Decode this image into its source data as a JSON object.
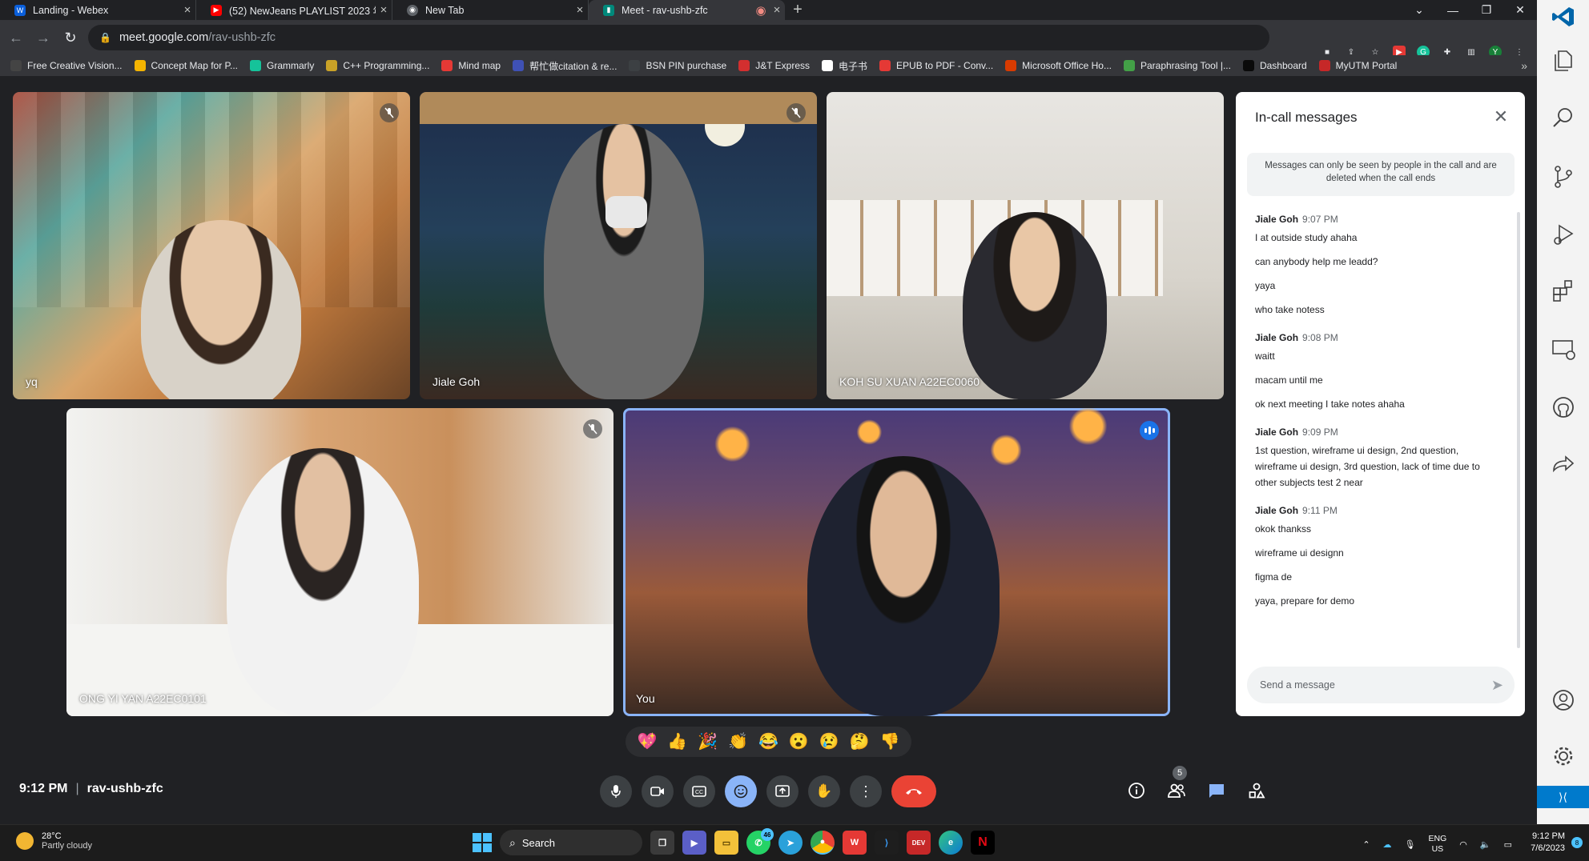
{
  "browser": {
    "tabs": [
      {
        "title": "Landing - Webex",
        "color": "#0a5fdb"
      },
      {
        "title": "(52) NewJeans PLAYLIST 2023 年",
        "color": "#ff0000"
      },
      {
        "title": "New Tab",
        "color": "#5f6368"
      },
      {
        "title": "Meet - rav-ushb-zfc",
        "color": "#00897b"
      }
    ],
    "url_host": "meet.google.com",
    "url_path": "/rav-ushb-zfc",
    "profile_initial": "Y",
    "bookmarks": [
      {
        "label": "Free Creative Vision...",
        "color": "#444444",
        "icon": "image-icon"
      },
      {
        "label": "Concept Map for P...",
        "color": "#f4b400",
        "icon": "concept-map-icon"
      },
      {
        "label": "Grammarly",
        "color": "#15c39a",
        "icon": "grammarly-icon"
      },
      {
        "label": "C++ Programming...",
        "color": "#c9a227",
        "icon": "cpp-icon"
      },
      {
        "label": "Mind map",
        "color": "#e53935",
        "icon": "mindmap-icon"
      },
      {
        "label": "帮忙做citation & re...",
        "color": "#3f51b5",
        "icon": "citation-icon"
      },
      {
        "label": "BSN PIN purchase",
        "color": "#3c4043",
        "icon": "globe-icon"
      },
      {
        "label": "J&T Express",
        "color": "#d32f2f",
        "icon": "jt-icon"
      },
      {
        "label": "电子书",
        "color": "#ffffff",
        "icon": "book-icon"
      },
      {
        "label": "EPUB to PDF - Conv...",
        "color": "#e53935",
        "icon": "epub-icon"
      },
      {
        "label": "Microsoft Office Ho...",
        "color": "#d83b01",
        "icon": "office-icon"
      },
      {
        "label": "Paraphrasing Tool |...",
        "color": "#43a047",
        "icon": "paraphrase-icon"
      },
      {
        "label": "Dashboard",
        "color": "#0a0a0a",
        "icon": "dashboard-icon"
      },
      {
        "label": "MyUTM Portal",
        "color": "#c62828",
        "icon": "utm-icon"
      }
    ]
  },
  "participants": [
    {
      "name": "yq",
      "muted": true
    },
    {
      "name": "Jiale Goh",
      "muted": true
    },
    {
      "name": "KOH SU XUAN A22EC0060",
      "muted": false
    },
    {
      "name": "ONG YI YAN A22EC0101",
      "muted": true
    },
    {
      "name": "You",
      "speaking": true
    }
  ],
  "chat": {
    "title": "In-call messages",
    "notice": "Messages can only be seen by people in the call and are deleted when the call ends",
    "groups": [
      {
        "sender": "Jiale Goh",
        "time": "9:07 PM",
        "lines": [
          "I at outside study ahaha",
          "can anybody help me leadd?",
          "yaya",
          "who take notess"
        ]
      },
      {
        "sender": "Jiale Goh",
        "time": "9:08 PM",
        "lines": [
          "waitt",
          "macam until me",
          "ok next meeting I take notes ahaha"
        ]
      },
      {
        "sender": "Jiale Goh",
        "time": "9:09 PM",
        "lines": [
          "1st question, wireframe ui design, 2nd question, wireframe ui design, 3rd question, lack of time due to other subjects test 2 near"
        ]
      },
      {
        "sender": "Jiale Goh",
        "time": "9:11 PM",
        "lines": [
          "okok thankss",
          "wireframe ui designn",
          "figma de",
          "yaya, prepare for demo"
        ]
      }
    ],
    "input_placeholder": "Send a message"
  },
  "reactions": [
    "💖",
    "👍",
    "🎉",
    "👏",
    "😂",
    "😮",
    "😢",
    "🤔",
    "👎"
  ],
  "meeting": {
    "time": "9:12 PM",
    "code": "rav-ushb-zfc",
    "people_count": "5"
  },
  "taskbar": {
    "temp": "28°C",
    "weather": "Partly cloudy",
    "search": "Search",
    "whatsapp_badge": "46",
    "lang_top": "ENG",
    "lang_bottom": "US",
    "time": "9:12 PM",
    "date": "7/6/2023",
    "notifications": "8"
  }
}
